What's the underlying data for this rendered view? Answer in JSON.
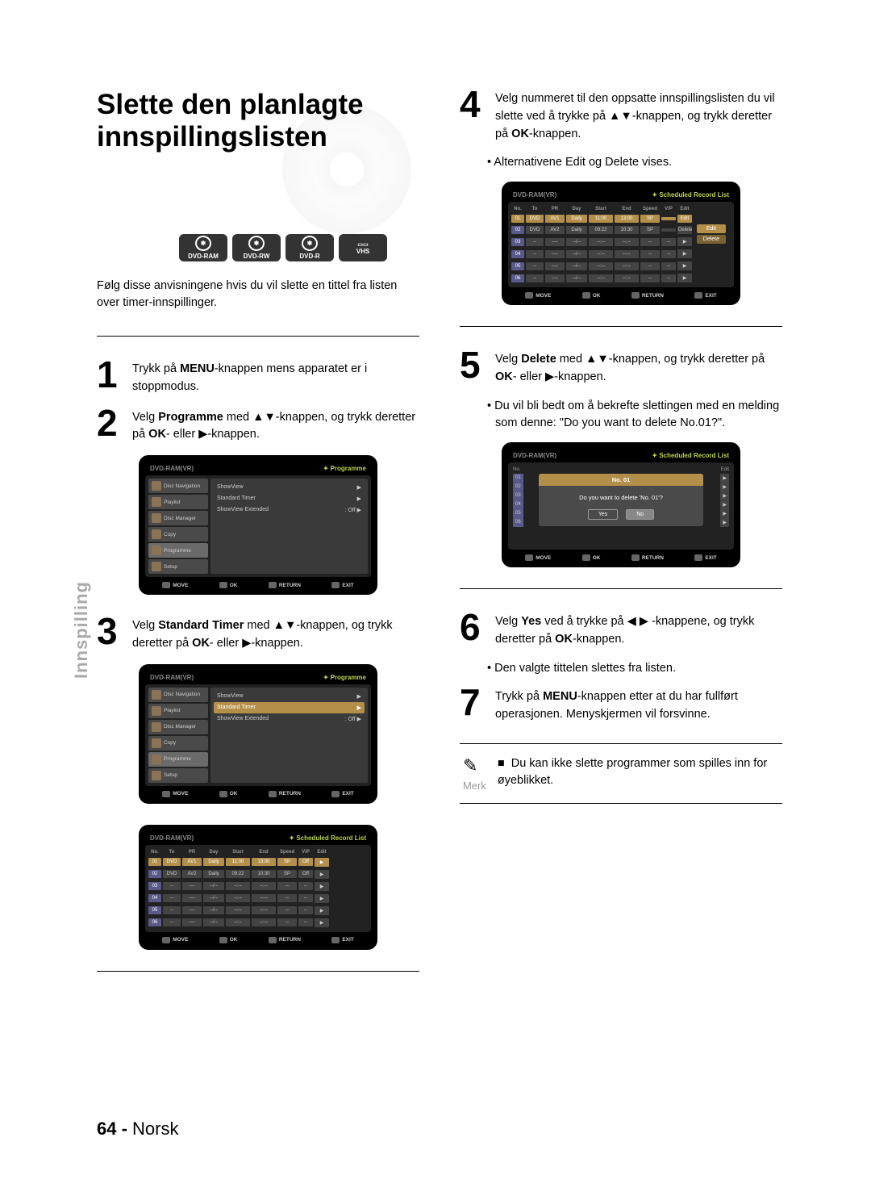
{
  "title": "Slette den planlagte innspillingslisten",
  "side_tab": "Innspilling",
  "formats": [
    "DVD-RAM",
    "DVD-RW",
    "DVD-R",
    "VHS"
  ],
  "intro": "Følg disse anvisningene hvis du vil slette en tittel fra listen over timer-innspillinger.",
  "steps": {
    "1": {
      "num": "1",
      "text_pre": "Trykk på ",
      "bold1": "MENU",
      "text_post": "-knappen mens apparatet er i stoppmodus."
    },
    "2": {
      "num": "2",
      "text_pre": "Velg ",
      "bold1": "Programme",
      "mid": " med ▲▼-knappen, og trykk deretter på ",
      "bold2": "OK",
      "mid2": "- eller ▶-knappen."
    },
    "3": {
      "num": "3",
      "text_pre": "Velg ",
      "bold1": "Standard Timer",
      "mid": " med ▲▼-knappen, og trykk deretter på ",
      "bold2": "OK",
      "mid2": "- eller ▶-knappen."
    },
    "4": {
      "num": "4",
      "text": "Velg nummeret til den oppsatte innspillingslisten du vil slette ved å trykke på ▲▼-knappen, og trykk deretter på ",
      "bold1": "OK",
      "post": "-knappen.",
      "bullet": "• Alternativene Edit og Delete vises."
    },
    "5": {
      "num": "5",
      "text_pre": "Velg ",
      "bold1": "Delete",
      "mid": " med ▲▼-knappen, og trykk deretter på ",
      "bold2": "OK",
      "mid2": "- eller ▶-knappen.",
      "bullet": "• Du vil bli bedt om å bekrefte slettingen med en melding som denne: \"Do you want to delete No.01?\"."
    },
    "6": {
      "num": "6",
      "text_pre": "Velg ",
      "bold1": "Yes",
      "mid": " ved å trykke på ◀ ▶ -knappene, og trykk deretter på ",
      "bold2": "OK",
      "post": "-knappen.",
      "bullet": "• Den valgte tittelen slettes fra listen."
    },
    "7": {
      "num": "7",
      "text_pre": "Trykk på ",
      "bold1": "MENU",
      "post": "-knappen etter at du har fullført operasjonen. Menyskjermen vil forsvinne."
    }
  },
  "note": {
    "label": "Merk",
    "bullet": "■",
    "text": "Du kan ikke slette programmer som spilles inn for øyeblikket."
  },
  "tv": {
    "header_left": "DVD-RAM(VR)",
    "prog_title": "Programme",
    "sched_title": "Scheduled Record List",
    "side_items": [
      "Disc Navigation",
      "Playlist",
      "Disc Manager",
      "Copy",
      "Programme",
      "Setup"
    ],
    "menu_items": [
      {
        "label": "ShowView",
        "val": "",
        "hl": false
      },
      {
        "label": "Standard Timer",
        "val": "",
        "hl": false
      },
      {
        "label": "ShowView Extended",
        "val": ": Off",
        "hl": false
      }
    ],
    "menu_items_hl": [
      {
        "label": "ShowView",
        "val": "",
        "hl": false
      },
      {
        "label": "Standard Timer",
        "val": "",
        "hl": true
      },
      {
        "label": "ShowView Extended",
        "val": ": Off",
        "hl": false
      }
    ],
    "sched_headers": [
      "No.",
      "To",
      "PR",
      "Day",
      "Start",
      "End",
      "Speed",
      "V/P",
      "Edit"
    ],
    "sched_rows": [
      {
        "no": "01",
        "to": "DVD",
        "pr": "AV1",
        "day": "Daily",
        "start": "11:00",
        "end": "13:00",
        "speed": "SP",
        "vp": "Off",
        "edit": "▶",
        "hl": true
      },
      {
        "no": "02",
        "to": "DVD",
        "pr": "AV2",
        "day": "Daily",
        "start": "09:22",
        "end": "10:30",
        "speed": "SP",
        "vp": "Off",
        "edit": "▶"
      },
      {
        "no": "03",
        "to": "--",
        "pr": "----",
        "day": "--/--",
        "start": "--:--",
        "end": "--:--",
        "speed": "--",
        "vp": "--",
        "edit": "▶"
      },
      {
        "no": "04",
        "to": "--",
        "pr": "----",
        "day": "--/--",
        "start": "--:--",
        "end": "--:--",
        "speed": "--",
        "vp": "--",
        "edit": "▶"
      },
      {
        "no": "05",
        "to": "--",
        "pr": "----",
        "day": "--/--",
        "start": "--:--",
        "end": "--:--",
        "speed": "--",
        "vp": "--",
        "edit": "▶"
      },
      {
        "no": "06",
        "to": "--",
        "pr": "----",
        "day": "--/--",
        "start": "--:--",
        "end": "--:--",
        "speed": "--",
        "vp": "--",
        "edit": "▶"
      }
    ],
    "sched_rows2": [
      {
        "no": "01",
        "to": "DVD",
        "pr": "AV1",
        "day": "Daily",
        "start": "11:00",
        "end": "13:00",
        "speed": "SP",
        "vp": "",
        "edit": "Edit",
        "hl": true
      },
      {
        "no": "02",
        "to": "DVD",
        "pr": "AV2",
        "day": "Daily",
        "start": "09:22",
        "end": "10:30",
        "speed": "SP",
        "vp": "",
        "edit": "Delete"
      },
      {
        "no": "03",
        "to": "--",
        "pr": "----",
        "day": "--/--",
        "start": "--:--",
        "end": "--:--",
        "speed": "--",
        "vp": "--",
        "edit": "▶"
      },
      {
        "no": "04",
        "to": "--",
        "pr": "----",
        "day": "--/--",
        "start": "--:--",
        "end": "--:--",
        "speed": "--",
        "vp": "--",
        "edit": "▶"
      },
      {
        "no": "05",
        "to": "--",
        "pr": "----",
        "day": "--/--",
        "start": "--:--",
        "end": "--:--",
        "speed": "--",
        "vp": "--",
        "edit": "▶"
      },
      {
        "no": "06",
        "to": "--",
        "pr": "----",
        "day": "--/--",
        "start": "--:--",
        "end": "--:--",
        "speed": "--",
        "vp": "--",
        "edit": "▶"
      }
    ],
    "popup": [
      "Edit",
      "Delete"
    ],
    "dialog": {
      "title": "No. 01",
      "msg": "Do you want to delete 'No. 01'?",
      "yes": "Yes",
      "no": "No"
    },
    "footer": [
      "MOVE",
      "OK",
      "RETURN",
      "EXIT"
    ]
  },
  "footer": {
    "page": "64 -",
    "lang": "Norsk"
  }
}
